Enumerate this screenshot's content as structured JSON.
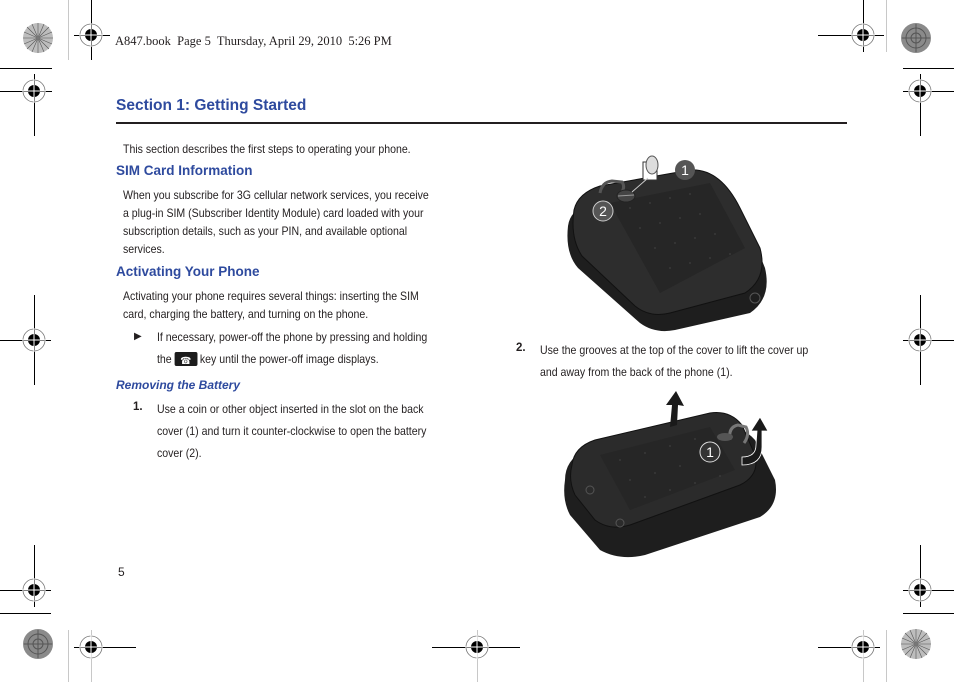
{
  "header": {
    "book_line": "A847.book  Page 5  Thursday, April 29, 2010  5:26 PM"
  },
  "section": {
    "title": "Section 1: Getting Started",
    "intro": "This section describes the first steps to operating your phone."
  },
  "sim_card": {
    "heading": "SIM Card Information",
    "lines": [
      "When you subscribe for 3G cellular network services, you receive",
      "a plug-in SIM (Subscriber Identity Module) card loaded with your",
      "subscription details, such as your PIN, and available optional",
      "services."
    ]
  },
  "activating": {
    "heading": "Activating Your Phone",
    "lines": [
      "Activating your phone requires several things: inserting the SIM",
      "card, charging the battery, and turning on the phone."
    ],
    "bullet_marker": "▶",
    "bullet_line1": "If necessary, power-off the phone by pressing and holding",
    "bullet_line2_before": "the",
    "bullet_key_icon": "end-power-key-icon",
    "bullet_key_glyph": "☎",
    "bullet_line2_after": "key until the power-off image displays."
  },
  "removing_battery": {
    "heading": "Removing the Battery",
    "steps": [
      {
        "number": "1.",
        "lines": [
          "Use a coin or other object inserted in the slot on the back",
          "cover (1) and turn it counter-clockwise to open the battery",
          "cover (2)."
        ]
      },
      {
        "number": "2.",
        "lines": [
          "Use the grooves at the top of the cover to lift the cover up",
          "and away from the back of the phone (1)."
        ]
      }
    ]
  },
  "figures": {
    "figure1": {
      "description": "Back of phone with coin slot lock",
      "callouts": [
        "1",
        "2"
      ]
    },
    "figure2": {
      "description": "Lifting battery cover off phone",
      "callouts": [
        "1"
      ]
    }
  },
  "footer": {
    "page_number": "5"
  },
  "colors": {
    "heading_blue": "#2e4a9e",
    "text": "#231f20",
    "phone_body": "#2b2b2b"
  }
}
